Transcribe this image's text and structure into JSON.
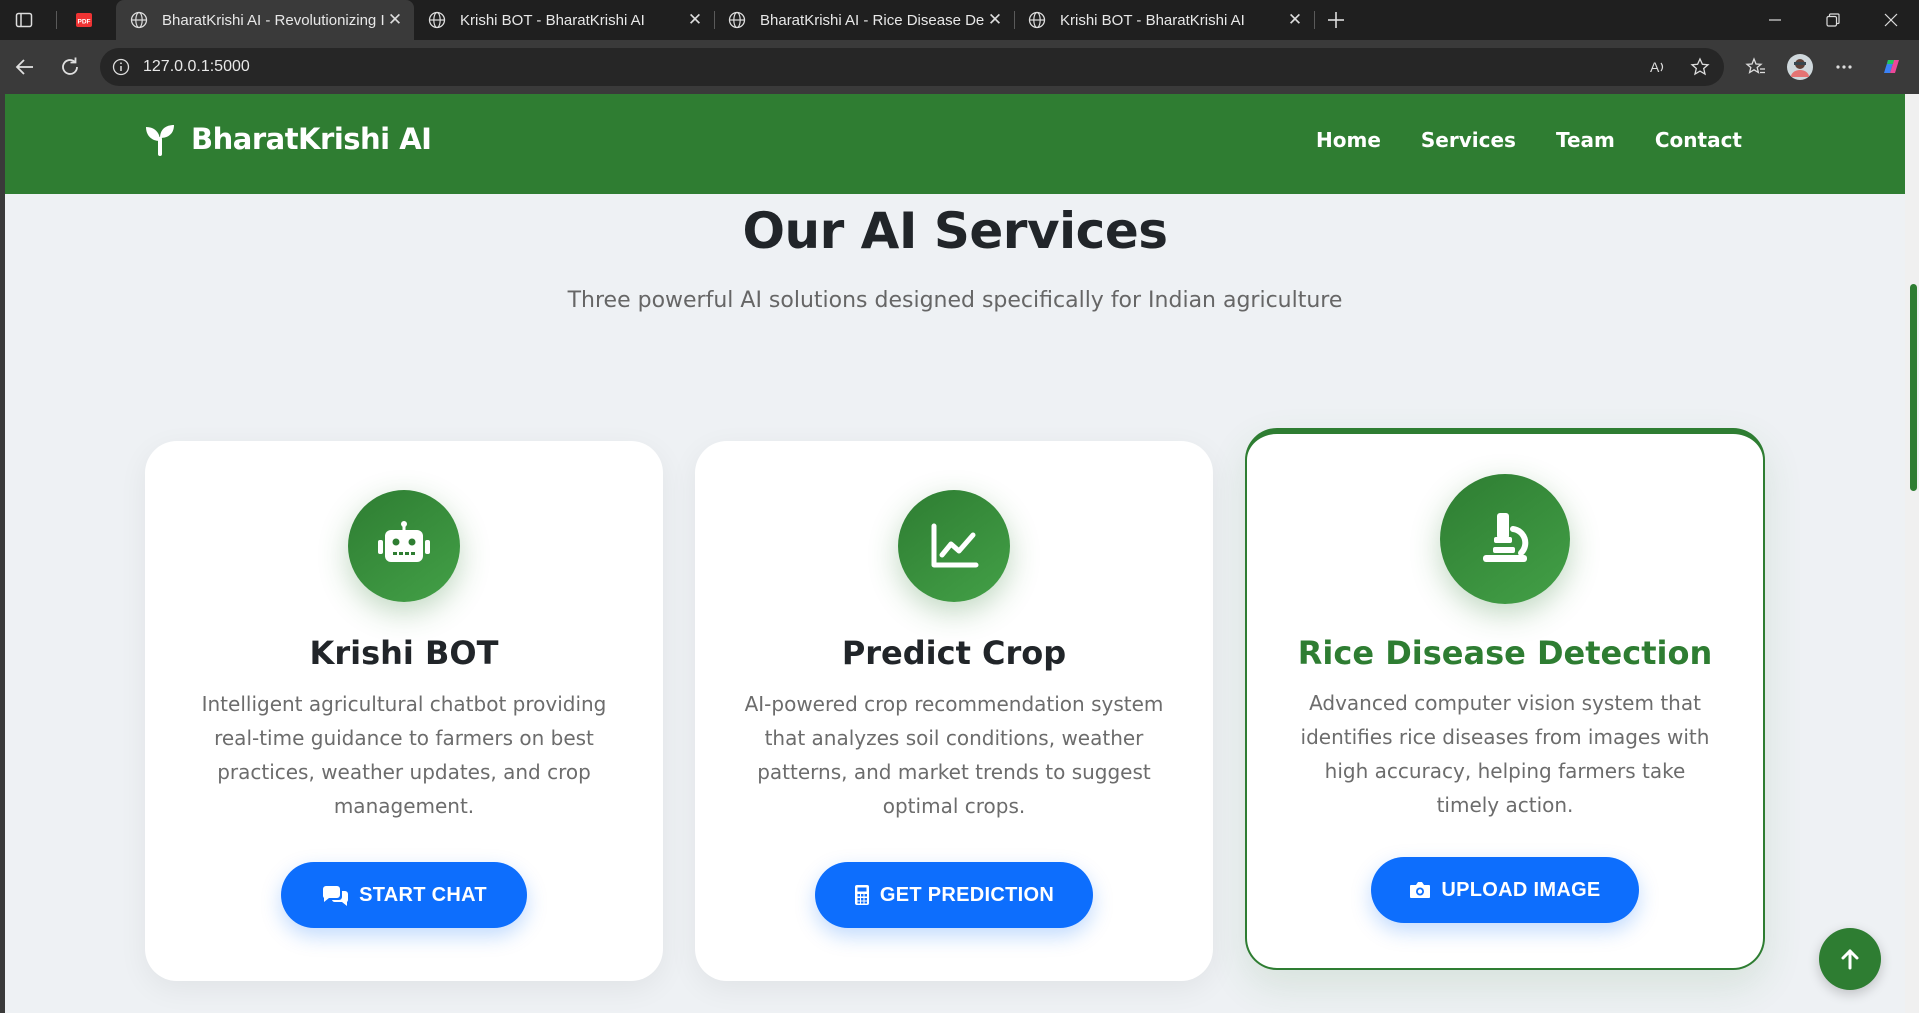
{
  "browser": {
    "tabs": [
      {
        "title": "BharatKrishi AI - Revolutionizing Indian Agriculture",
        "active": true
      },
      {
        "title": "Krishi BOT - BharatKrishi AI",
        "active": false
      },
      {
        "title": "BharatKrishi AI - Rice Disease Detection",
        "active": false
      },
      {
        "title": "Krishi BOT - BharatKrishi AI",
        "active": false
      }
    ],
    "url": "127.0.0.1:5000"
  },
  "site": {
    "brand": "BharatKrishi AI",
    "nav": [
      "Home",
      "Services",
      "Team",
      "Contact"
    ]
  },
  "services": {
    "title": "Our AI Services",
    "subtitle": "Three powerful AI solutions designed specifically for Indian agriculture",
    "cards": [
      {
        "icon": "robot-icon",
        "title": "Krishi BOT",
        "description": "Intelligent agricultural chatbot providing real-time guidance to farmers on best practices, weather updates, and crop management.",
        "button": "START CHAT",
        "button_icon": "chat-bubbles-icon"
      },
      {
        "icon": "chart-line-icon",
        "title": "Predict Crop",
        "description": "AI-powered crop recommendation system that analyzes soil conditions, weather patterns, and market trends to suggest optimal crops.",
        "button": "GET PREDICTION",
        "button_icon": "calculator-icon"
      },
      {
        "icon": "microscope-icon",
        "title": "Rice Disease Detection",
        "description": "Advanced computer vision system that identifies rice diseases from images with high accuracy, helping farmers take timely action.",
        "button": "UPLOAD IMAGE",
        "button_icon": "camera-icon"
      }
    ]
  },
  "colors": {
    "brand_green": "#2f7d32",
    "button_blue": "#0d6efd",
    "title_dark": "#212529"
  }
}
